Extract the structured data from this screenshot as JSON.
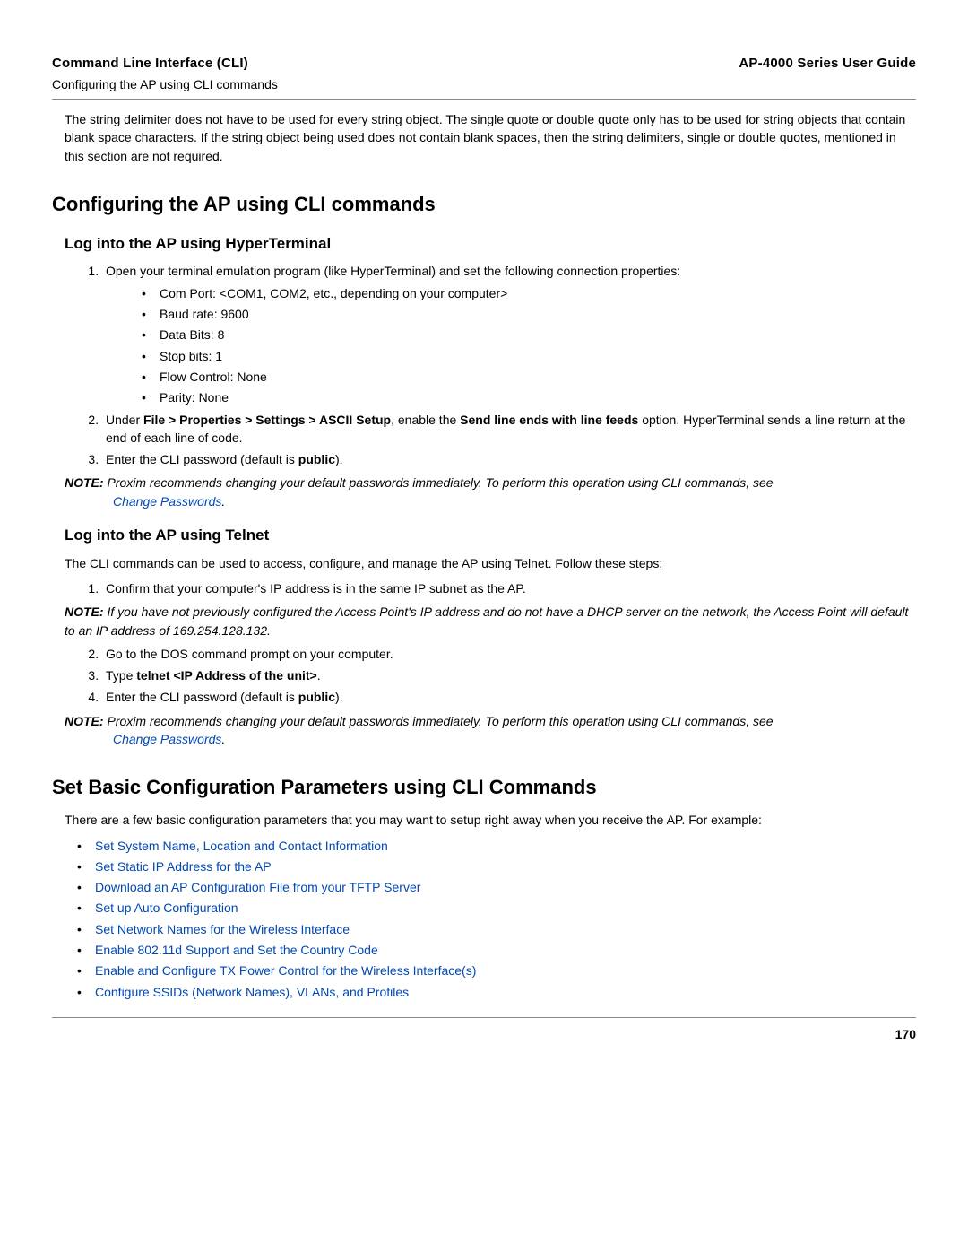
{
  "header": {
    "left_title": "Command Line Interface (CLI)",
    "left_subtitle": "Configuring the AP using CLI commands",
    "right_title": "AP-4000 Series User Guide"
  },
  "intro_para": "The string delimiter does not have to be used for every string object. The single quote or double quote only has to be used for string objects that contain blank space characters. If the string object being used does not contain blank spaces, then the string delimiters, single or double quotes, mentioned in this section are not required.",
  "section1_title": "Configuring the AP using CLI commands",
  "hyper": {
    "title": "Log into the AP using HyperTerminal",
    "step1": "Open your terminal emulation program (like HyperTerminal) and set the following connection properties:",
    "props": {
      "a": "Com Port: <COM1, COM2, etc., depending on your computer>",
      "b": "Baud rate: 9600",
      "c": "Data Bits: 8",
      "d": "Stop bits: 1",
      "e": "Flow Control: None",
      "f": "Parity: None"
    },
    "step2_pre": "Under ",
    "step2_bold1": "File > Properties > Settings > ASCII Setup",
    "step2_mid": ", enable the ",
    "step2_bold2": "Send line ends with line feeds",
    "step2_post": " option. HyperTerminal sends a line return at the end of each line of code.",
    "step3_pre": "Enter the CLI password (default is ",
    "step3_bold": "public",
    "step3_post": ")."
  },
  "note_label": "NOTE:",
  "note1": {
    "text1": "Proxim recommends changing your default passwords immediately. To perform this operation using CLI commands, see ",
    "link": "Change Passwords",
    "text2": "."
  },
  "telnet": {
    "title": "Log into the AP using Telnet",
    "intro": "The CLI commands can be used to access, configure, and manage the AP using Telnet. Follow these steps:",
    "step1": "Confirm that your computer's IP address is in the same IP subnet as the AP.",
    "note_text": "If you have not previously configured the Access Point's IP address and do not have a DHCP server on the network, the Access Point will default to an IP address of 169.254.128.132.",
    "step2": "Go to the DOS command prompt on your computer.",
    "step3_pre": "Type ",
    "step3_bold": "telnet <IP Address of the unit>",
    "step3_post": ".",
    "step4_pre": "Enter the CLI password (default is ",
    "step4_bold": "public",
    "step4_post": ")."
  },
  "note3": {
    "text1": "Proxim recommends changing your default passwords immediately. To perform this operation using CLI commands, see ",
    "link": "Change Passwords",
    "text2": "."
  },
  "section2_title": "Set Basic Configuration Parameters using CLI Commands",
  "section2_intro": "There are a few basic configuration parameters that you may want to setup right away when you receive the AP. For example:",
  "links": {
    "a": "Set System Name, Location and Contact Information",
    "b": "Set Static IP Address for the AP",
    "c": "Download an AP Configuration File from your TFTP Server",
    "d": "Set up Auto Configuration",
    "e": "Set Network Names for the Wireless Interface",
    "f": "Enable 802.11d Support and Set the Country Code",
    "g": "Enable and Configure TX Power Control for the Wireless Interface(s)",
    "h": "Configure SSIDs (Network Names), VLANs, and Profiles"
  },
  "page_number": "170"
}
